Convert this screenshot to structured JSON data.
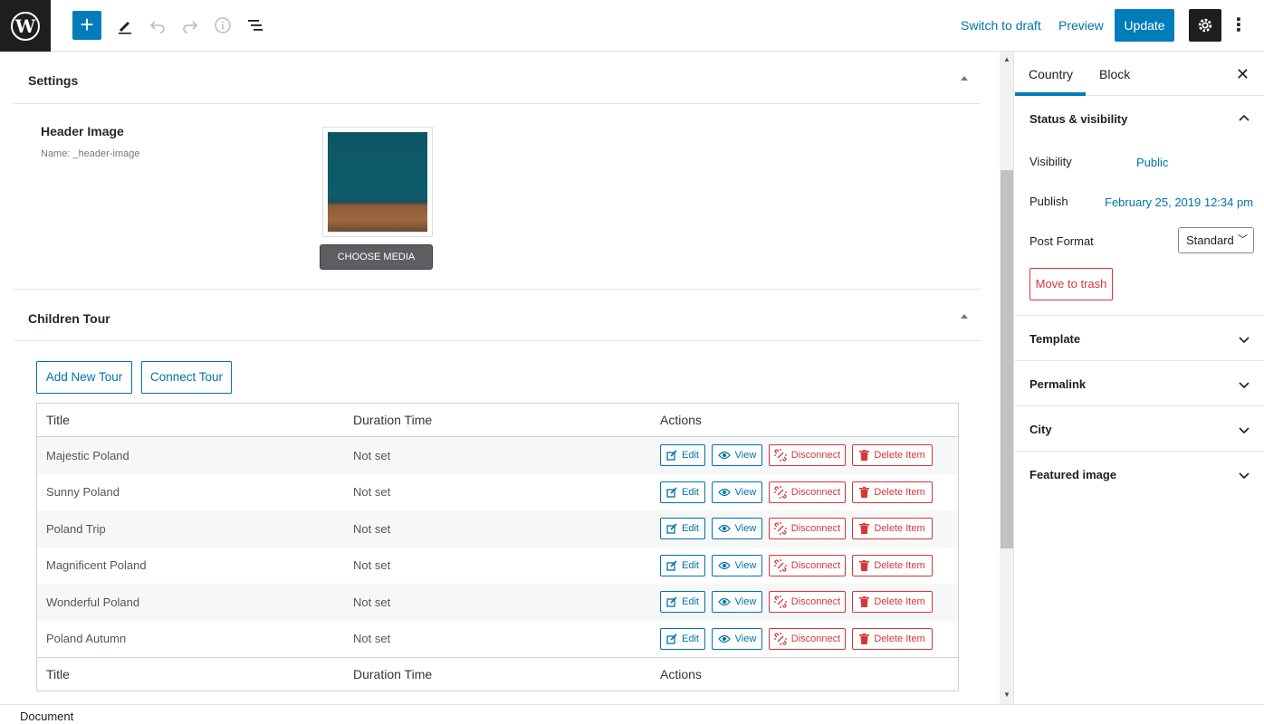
{
  "toolbar": {
    "switch_to_draft": "Switch to draft",
    "preview": "Preview",
    "update": "Update",
    "add_icon": "plus-icon"
  },
  "editor": {
    "settings_panel": {
      "title": "Settings",
      "field_label": "Header Image",
      "field_name": "Name: _header-image",
      "choose_media": "CHOOSE MEDIA"
    },
    "children_panel": {
      "title": "Children Tour",
      "add_new": "Add New Tour",
      "connect": "Connect Tour",
      "columns": [
        "Title",
        "Duration Time",
        "Actions"
      ],
      "rows": [
        {
          "title": "Majestic Poland",
          "duration": "Not set"
        },
        {
          "title": "Sunny Poland",
          "duration": "Not set"
        },
        {
          "title": "Poland Trip",
          "duration": "Not set"
        },
        {
          "title": "Magnificent Poland",
          "duration": "Not set"
        },
        {
          "title": "Wonderful Poland",
          "duration": "Not set"
        },
        {
          "title": "Poland Autumn",
          "duration": "Not set"
        }
      ],
      "actions": {
        "edit": "Edit",
        "view": "View",
        "disconnect": "Disconnect",
        "delete": "Delete Item"
      }
    }
  },
  "sidebar": {
    "tabs": [
      "Country",
      "Block"
    ],
    "status_visibility": {
      "title": "Status & visibility",
      "visibility_label": "Visibility",
      "visibility_value": "Public",
      "publish_label": "Publish",
      "publish_value": "February 25, 2019 12:34 pm",
      "post_format_label": "Post Format",
      "post_format_value": "Standard",
      "trash": "Move to trash"
    },
    "sections": [
      "Template",
      "Permalink",
      "City",
      "Featured image"
    ]
  },
  "footer": {
    "breadcrumb": "Document"
  }
}
